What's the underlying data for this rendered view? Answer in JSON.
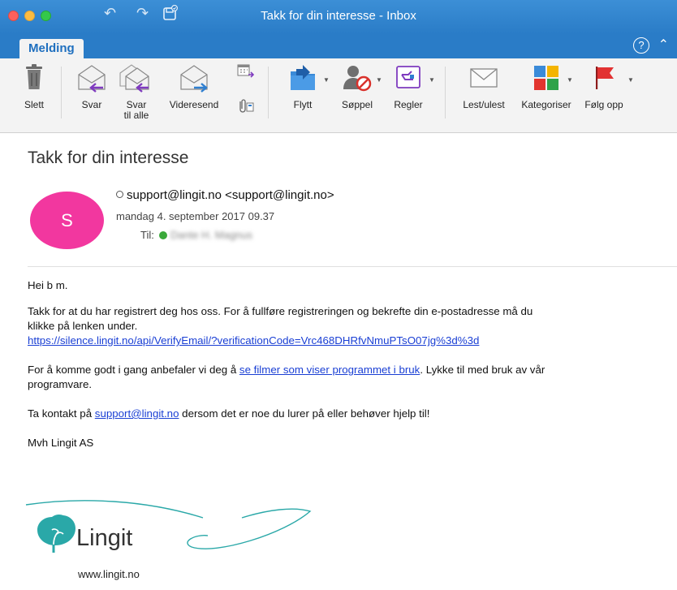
{
  "window": {
    "title": "Takk for din interesse  - Inbox"
  },
  "ribbon": {
    "active_tab": "Melding",
    "help_label": "?",
    "buttons": {
      "delete": "Slett",
      "reply": "Svar",
      "reply_all_line1": "Svar",
      "reply_all_line2": "til alle",
      "forward": "Videresend",
      "move": "Flytt",
      "junk": "Søppel",
      "rules": "Regler",
      "read_unread": "Lest/ulest",
      "categorize": "Kategoriser",
      "follow_up": "Følg opp"
    }
  },
  "message": {
    "subject": "Takk for din interesse",
    "avatar_letter": "S",
    "avatar_color": "#f2379f",
    "from": "support@lingit.no <support@lingit.no>",
    "date": "mandag 4. september 2017 09.37",
    "to_label": "Til:",
    "to_value": "Dante H. Magnus",
    "body": {
      "greeting": "Hei b m.",
      "p1_line1": "Takk for at du har registrert deg hos oss. For å fullføre registreringen og bekrefte din e-postadresse må du",
      "p1_line2": "klikke på lenken under.",
      "verify_link": "https://silence.lingit.no/api/VerifyEmail/?verificationCode=Vrc468DHRfvNmuPTsO07jg%3d%3d",
      "p2_before": "For å komme godt i gang anbefaler vi deg å ",
      "p2_link": "se filmer som viser programmet i bruk",
      "p2_after": ". Lykke til med bruk av vår",
      "p2_line2": "programvare.",
      "p3_before": "Ta kontakt på ",
      "p3_link": "support@lingit.no",
      "p3_after": " dersom det er noe du lurer på eller behøver hjelp til!",
      "signoff": "Mvh Lingit AS"
    },
    "logo": {
      "word": "Lingit",
      "url": "www.lingit.no",
      "accent": "#2aa8a8"
    }
  }
}
